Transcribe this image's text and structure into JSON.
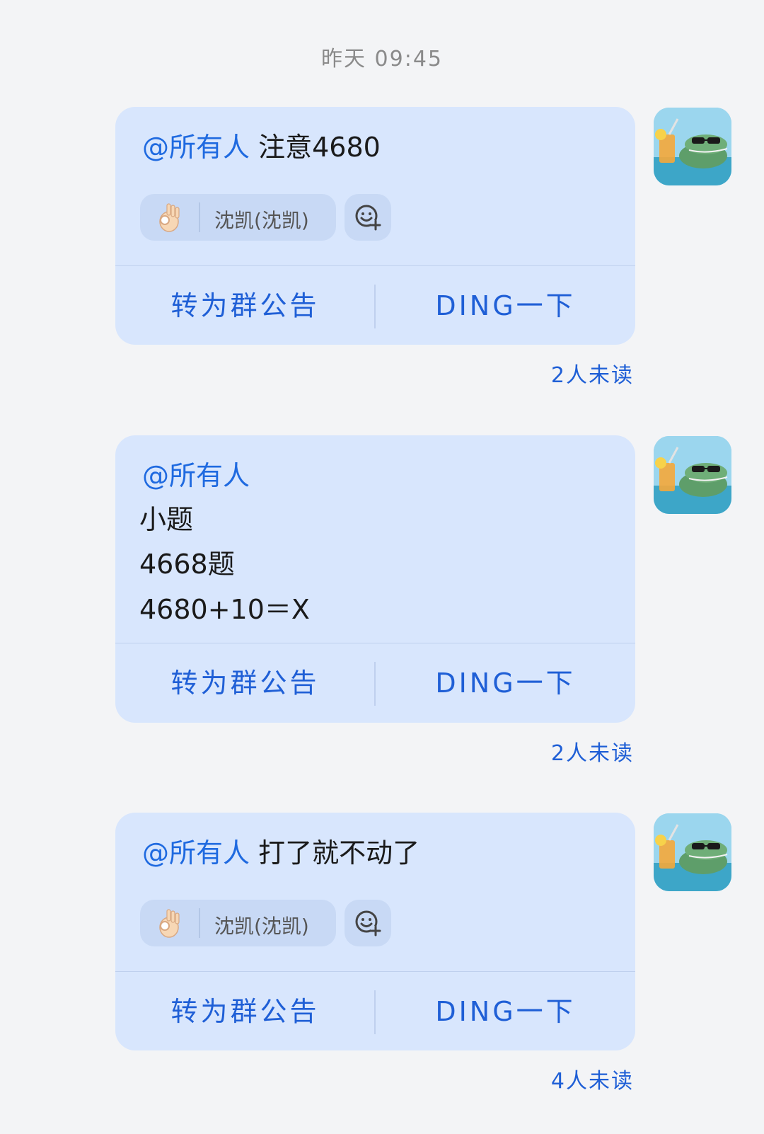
{
  "timestamp": "昨天 09:45",
  "messages": [
    {
      "mention": "@所有人",
      "text": " 注意4680",
      "reaction": {
        "emoji_icon": "ok-hand-emoji",
        "who": "沈凯(沈凯)"
      },
      "actions": {
        "announce": "转为群公告",
        "ding": "DING一下"
      },
      "unread": "2人未读"
    },
    {
      "mention": "@所有人",
      "lines": [
        "小题",
        "4668题",
        "4680+10＝X"
      ],
      "actions": {
        "announce": "转为群公告",
        "ding": "DING一下"
      },
      "unread": "2人未读"
    },
    {
      "mention": "@所有人",
      "text": " 打了就不动了",
      "reaction": {
        "emoji_icon": "ok-hand-emoji",
        "who": "沈凯(沈凯)"
      },
      "actions": {
        "announce": "转为群公告",
        "ding": "DING一下"
      },
      "unread": "4人未读"
    }
  ],
  "colors": {
    "bubble": "#d8e6fd",
    "accent": "#1f5fd6",
    "background": "#f3f4f6"
  },
  "icons": {
    "avatar": "crocodile-avatar",
    "add_reaction": "add-emoji-icon"
  }
}
